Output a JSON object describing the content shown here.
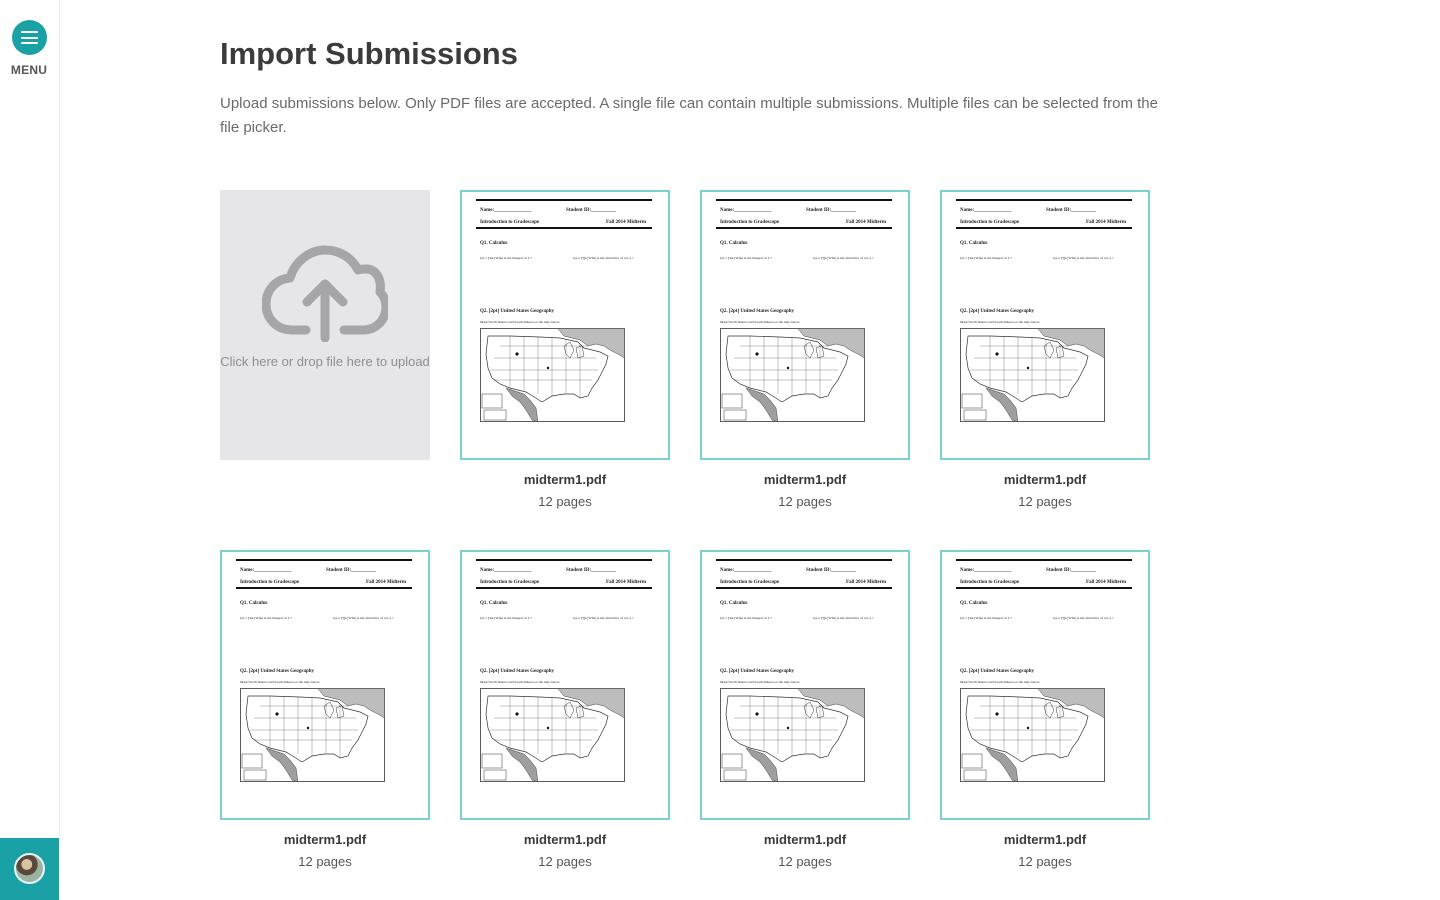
{
  "sidebar": {
    "menu_label": "MENU",
    "menu_icon": "hamburger-icon",
    "avatar_icon": "user-avatar"
  },
  "page": {
    "title": "Import Submissions",
    "description": "Upload submissions below. Only PDF files are accepted. A single file can contain multiple submissions. Multiple files can be selected from the file picker."
  },
  "upload": {
    "text": "Click here or drop file here to upload",
    "icon": "cloud-upload-icon"
  },
  "document_preview": {
    "name_label": "Name:_______________",
    "student_id_label": "Student ID:__________",
    "course": "Introduction to Gradescope",
    "term": "Fall 2014 Midterm",
    "q1": "Q1.  Calculus",
    "q1_1": "Q1.1  [3pt] What is the integral of x ?",
    "q1_2": "Q1.2  [3pt] What is the derivative of  cos x ?",
    "q2": "Q2.  [2pt] United States Geography",
    "q2_sub": "Mark North Dakota and South Dakota on the map below."
  },
  "files": [
    {
      "name": "midterm1.pdf",
      "pages": "12 pages"
    },
    {
      "name": "midterm1.pdf",
      "pages": "12 pages"
    },
    {
      "name": "midterm1.pdf",
      "pages": "12 pages"
    },
    {
      "name": "midterm1.pdf",
      "pages": "12 pages"
    },
    {
      "name": "midterm1.pdf",
      "pages": "12 pages"
    },
    {
      "name": "midterm1.pdf",
      "pages": "12 pages"
    },
    {
      "name": "midterm1.pdf",
      "pages": "12 pages"
    }
  ],
  "colors": {
    "accent": "#1aa1a6",
    "card_border": "#79d2ce",
    "upload_bg": "#e6e6e8"
  }
}
